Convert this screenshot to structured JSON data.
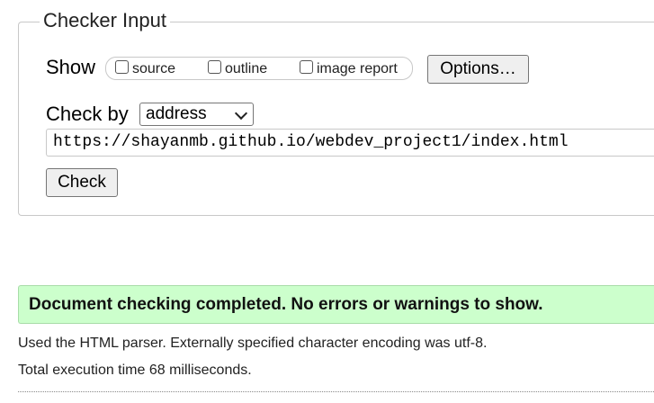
{
  "checker": {
    "legend": "Checker Input",
    "show_label": "Show",
    "options": [
      {
        "label": "source",
        "checked": false
      },
      {
        "label": "outline",
        "checked": false
      },
      {
        "label": "image report",
        "checked": false
      }
    ],
    "options_button": "Options…",
    "checkby_label": "Check by",
    "checkby_select": {
      "selected": "address"
    },
    "url_value": "https://shayanmb.github.io/webdev_project1/index.html",
    "check_button": "Check"
  },
  "result": {
    "success_message": "Document checking completed. No errors or warnings to show.",
    "parser_info": "Used the HTML parser. Externally specified character encoding was utf-8.",
    "execution_time": "Total execution time 68 milliseconds."
  },
  "colors": {
    "success_background": "#ccffcc",
    "border": "#c8c8c8"
  }
}
